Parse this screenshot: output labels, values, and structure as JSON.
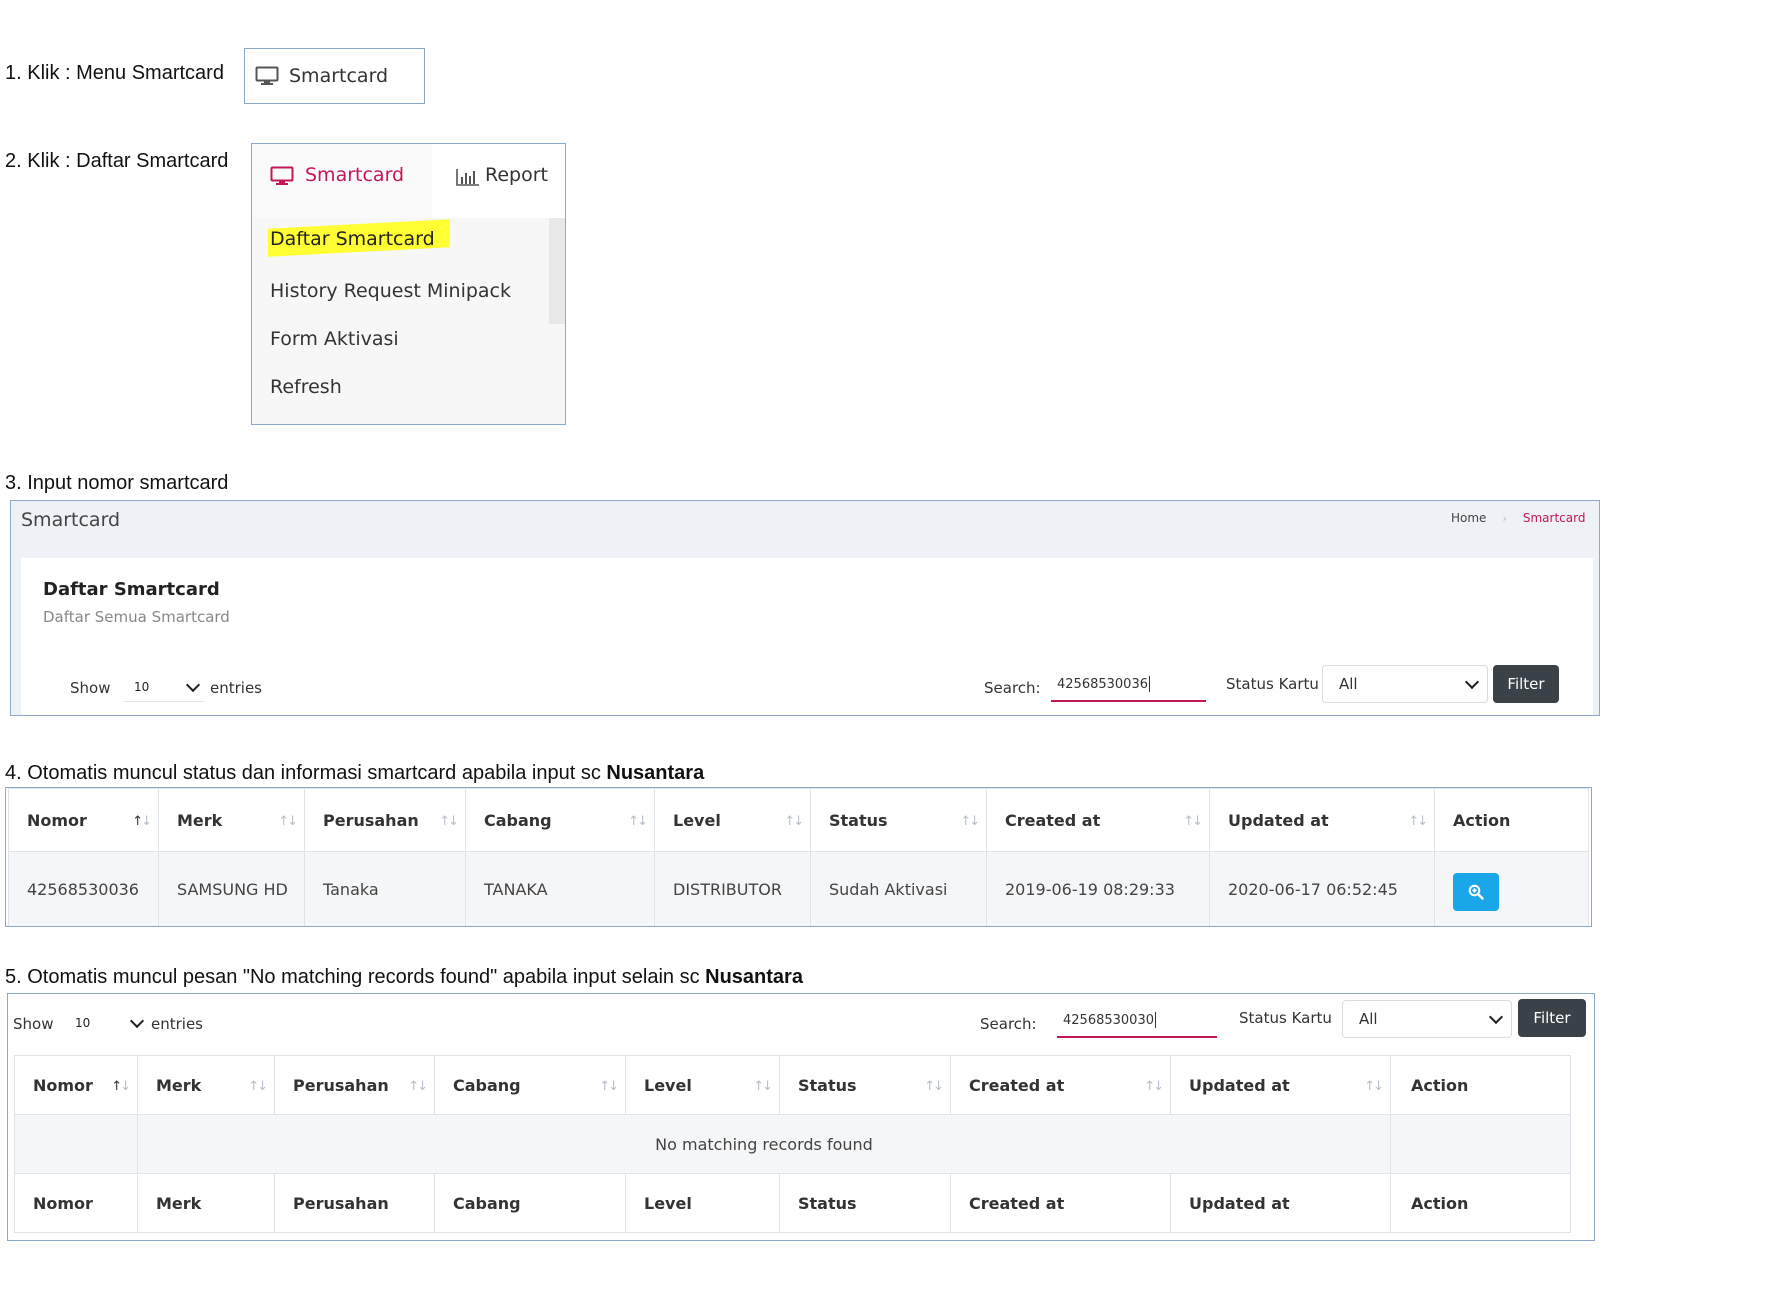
{
  "steps": {
    "s1": "1. Klik : Menu Smartcard",
    "s2": "2. Klik : Daftar Smartcard",
    "s3": "3. Input nomor smartcard",
    "s4_prefix": "4. Otomatis muncul status dan informasi smartcard apabila input sc ",
    "s4_bold": "Nusantara",
    "s5_prefix": "5. Otomatis muncul pesan \"No matching records found\" apabila input selain sc ",
    "s5_bold": "Nusantara"
  },
  "step1_button": {
    "label": "Smartcard",
    "icon": "monitor-icon"
  },
  "step2_menu": {
    "tabs": [
      {
        "label": "Smartcard",
        "icon": "monitor-icon",
        "active": true
      },
      {
        "label": "Report",
        "icon": "bar-chart-icon",
        "active": false
      }
    ],
    "items": [
      "Daftar Smartcard",
      "History Request Minipack",
      "Form Aktivasi",
      "Refresh"
    ],
    "highlight_color": "#ffff33",
    "accent": "#c2185b"
  },
  "step3_panel": {
    "page_title": "Smartcard",
    "breadcrumb": {
      "home": "Home",
      "current": "Smartcard"
    },
    "card_title": "Daftar Smartcard",
    "card_subtitle": "Daftar Semua Smartcard",
    "show_label": "Show",
    "entries_value": "10",
    "entries_label": "entries",
    "search_label": "Search:",
    "search_value": "42568530036",
    "status_label": "Status Kartu",
    "status_value": "All",
    "filter_label": "Filter"
  },
  "step4_table": {
    "columns": [
      "Nomor",
      "Merk",
      "Perusahan",
      "Cabang",
      "Level",
      "Status",
      "Created at",
      "Updated at",
      "Action"
    ],
    "row": [
      "42568530036",
      "SAMSUNG HD",
      "Tanaka",
      "TANAKA",
      "DISTRIBUTOR",
      "Sudah Aktivasi",
      "2019-06-19 08:29:33",
      "2020-06-17 06:52:45"
    ],
    "action_icon": "zoom-in-icon",
    "action_color": "#1aa6e8"
  },
  "step5_panel": {
    "show_label": "Show",
    "entries_value": "10",
    "entries_label": "entries",
    "search_label": "Search:",
    "search_value": "42568530030",
    "status_label": "Status Kartu",
    "status_value": "All",
    "filter_label": "Filter",
    "columns": [
      "Nomor",
      "Merk",
      "Perusahan",
      "Cabang",
      "Level",
      "Status",
      "Created at",
      "Updated at",
      "Action"
    ],
    "empty_message": "No matching records found",
    "footer_columns": [
      "Nomor",
      "Merk",
      "Perusahan",
      "Cabang",
      "Level",
      "Status",
      "Created at",
      "Updated at",
      "Action"
    ]
  }
}
